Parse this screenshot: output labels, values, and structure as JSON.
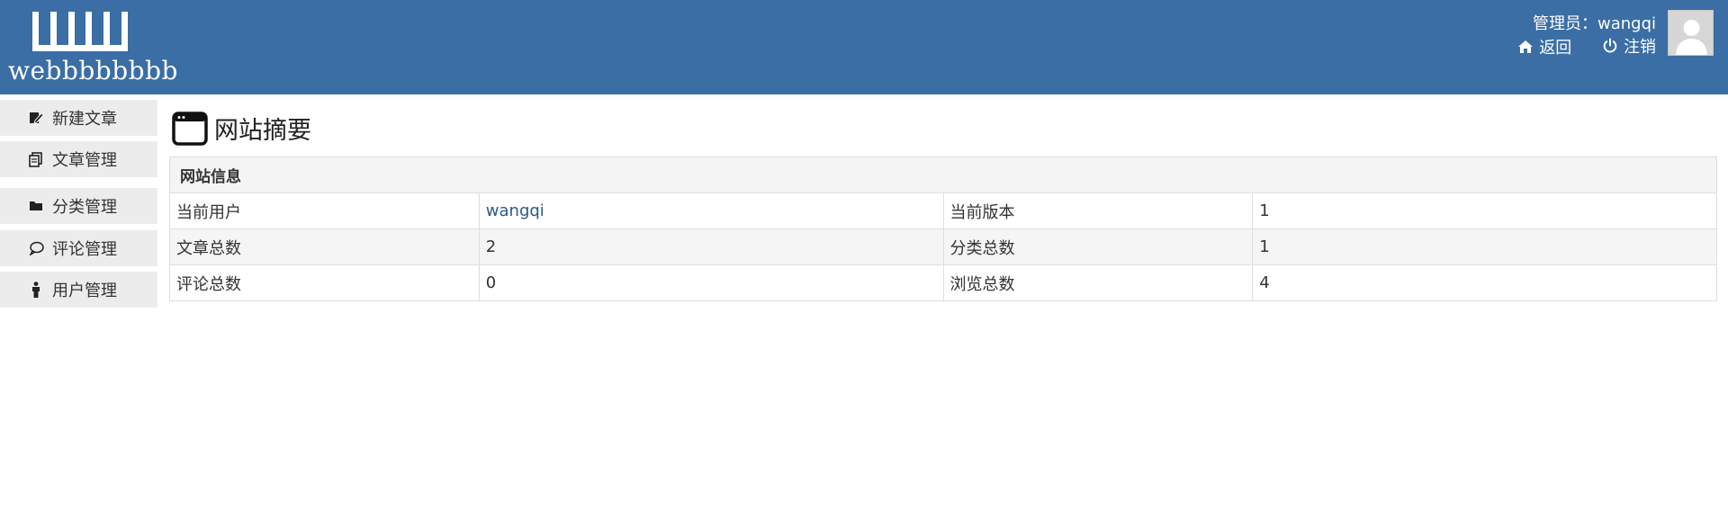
{
  "header": {
    "logo_text": "webbbbbbbb",
    "admin_label": "管理员：",
    "admin_name": "wangqi",
    "back_label": "返回",
    "logout_label": "注销"
  },
  "sidebar": {
    "items": [
      {
        "label": "新建文章",
        "icon": "edit-icon"
      },
      {
        "label": "文章管理",
        "icon": "document-icon"
      },
      {
        "label": "分类管理",
        "icon": "folder-icon"
      },
      {
        "label": "评论管理",
        "icon": "comment-icon"
      },
      {
        "label": "用户管理",
        "icon": "user-icon"
      }
    ]
  },
  "main": {
    "title": "网站摘要",
    "section_header": "网站信息",
    "rows": [
      {
        "k1": "当前用户",
        "v1": "wangqi",
        "k2": "当前版本",
        "v2": "1"
      },
      {
        "k1": "文章总数",
        "v1": "2",
        "k2": "分类总数",
        "v2": "1"
      },
      {
        "k1": "评论总数",
        "v1": "0",
        "k2": "浏览总数",
        "v2": "4"
      }
    ]
  },
  "colors": {
    "header_bg": "#3a6ea5",
    "sidebar_bg": "#ececec",
    "link": "#2a5a8c"
  }
}
